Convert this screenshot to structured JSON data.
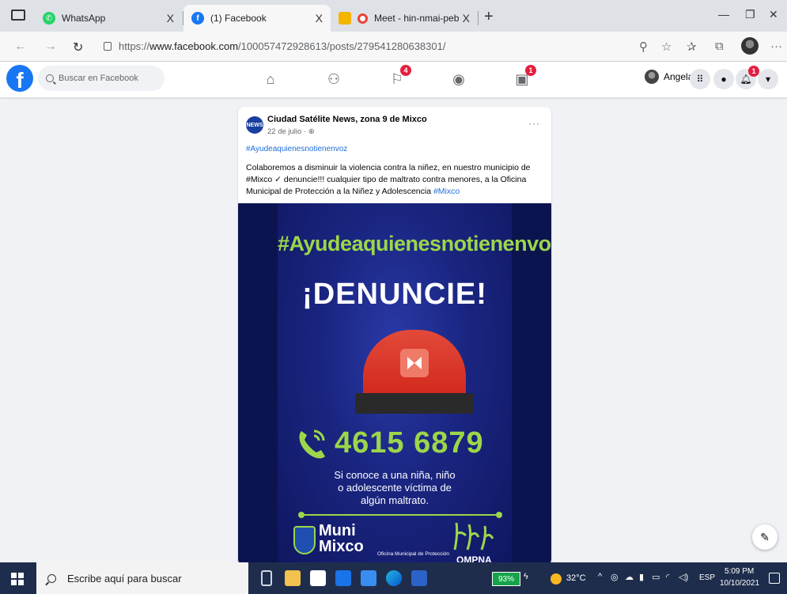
{
  "browser": {
    "tabs": [
      {
        "title": "WhatsApp",
        "favicon": "whatsapp-icon",
        "active": false
      },
      {
        "title": "(1) Facebook",
        "favicon": "facebook-icon",
        "active": true
      },
      {
        "title": "Meet - hin-nmai-peb",
        "favicon": "meet-icon",
        "active": false
      }
    ],
    "tab_close": "X",
    "new_tab": "+",
    "url_prefix": "https://",
    "url_domain": "www.facebook.com",
    "url_path": "/100057472928613/posts/279541280638301/"
  },
  "facebook": {
    "search_placeholder": "Buscar en Facebook",
    "nav": [
      {
        "name": "home-icon",
        "badge": ""
      },
      {
        "name": "friends-icon",
        "badge": ""
      },
      {
        "name": "pages-flag-icon",
        "badge": "4"
      },
      {
        "name": "groups-icon",
        "badge": ""
      },
      {
        "name": "gaming-icon",
        "badge": "1"
      }
    ],
    "user_name": "Angela",
    "notifications_badge": "1"
  },
  "post": {
    "page_avatar_text": "NEWS",
    "page_name": "Ciudad Satélite News, zona 9 de Mixco",
    "date": "22 de julio · ",
    "more": "···",
    "hashtag_line": "#Ayudeaquienesnotienenvoz",
    "text_main": "Colaboremos a disminuir la violencia contra la niñez, en nuestro municipio de #Mixco ✓ denuncie!!! cualquier tipo de maltrato contra menores, a la Oficina Municipal de Protección a la Niñez y Adolescencia ",
    "text_tag": "#Mixco",
    "image": {
      "hashtag": "#Ayudeaquienesnotienenvoz",
      "title": "¡DENUNCIE!",
      "phone": "4615 6879",
      "message_l1": "Si conoce a una niña, niño",
      "message_l2": "o adolescente víctima de",
      "message_l3": "algún maltrato.",
      "muni_l1": "Muni",
      "muni_l2": "Mixco",
      "omnna_label": "Oficina Municipal de Protección",
      "omnna_text": "OMPNA"
    }
  },
  "taskbar": {
    "search_placeholder": "Escribe aquí para buscar",
    "battery": "93%",
    "temperature": "32°C",
    "language": "ESP",
    "time": "5:09 PM",
    "date": "10/10/2021"
  },
  "colors": {
    "facebook_blue": "#1877f2",
    "badge_red": "#e41e3f",
    "poster_green": "#9cd64a",
    "poster_navy": "#1a2580"
  }
}
